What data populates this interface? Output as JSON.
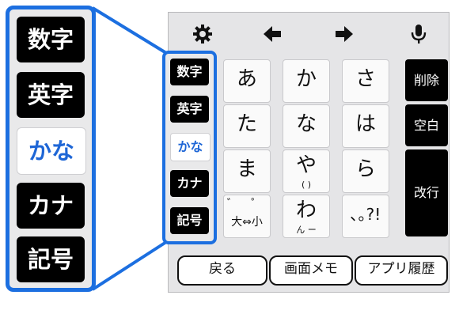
{
  "colors": {
    "accent": "#1c6fe0",
    "active_text": "#1e66d6",
    "key_dark": "#000000"
  },
  "toolbar": {
    "icons": [
      "gear-icon",
      "arrow-left-icon",
      "arrow-right-icon",
      "microphone-icon"
    ]
  },
  "modes": {
    "numbers": "数字",
    "alphabet": "英字",
    "hiragana": "かな",
    "katakana": "カナ",
    "symbols": "記号",
    "active": "かな"
  },
  "keys": {
    "a": "あ",
    "ka": "か",
    "sa": "さ",
    "ta": "た",
    "na": "な",
    "ha": "は",
    "ma": "ま",
    "ya": "や",
    "ya_sub": "(  )",
    "ra": "ら",
    "dakuten_top": "゛ ゜",
    "dakuten_label": "大⇔小",
    "wa": "わ",
    "wa_sub": "ん ー",
    "punct": "､｡?!"
  },
  "functions": {
    "delete": "削除",
    "space": "空白",
    "enter": "改行"
  },
  "bottom": {
    "back": "戻る",
    "memo": "画面メモ",
    "history": "アプリ履歴"
  }
}
